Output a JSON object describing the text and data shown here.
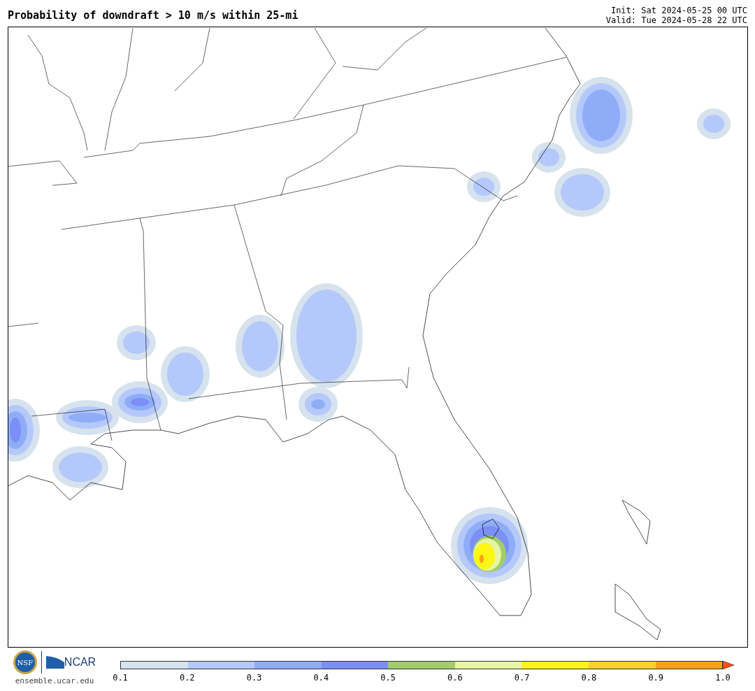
{
  "title": "Probability of downdraft > 10 m/s within 25-mi",
  "init": "Init: Sat 2024-05-25 00 UTC",
  "valid": "Valid: Tue 2024-05-28 22 UTC",
  "logos": {
    "nsf": "NSF",
    "ncar": "NCAR",
    "url": "ensemble.ucar.edu"
  },
  "colorbar": {
    "bins": [
      {
        "color": "#d6e2ed"
      },
      {
        "color": "#b4c8fb"
      },
      {
        "color": "#8fadf7"
      },
      {
        "color": "#7b8ff6"
      },
      {
        "color": "#a3cd6b"
      },
      {
        "color": "#e6f5a3"
      },
      {
        "color": "#fdf614"
      },
      {
        "color": "#fdd126"
      },
      {
        "color": "#fba112"
      }
    ],
    "extend": {
      "color": "#f0501a"
    },
    "ticks": [
      "0.1",
      "0.2",
      "0.3",
      "0.4",
      "0.5",
      "0.6",
      "0.7",
      "0.8",
      "0.9",
      "1.0"
    ]
  }
}
